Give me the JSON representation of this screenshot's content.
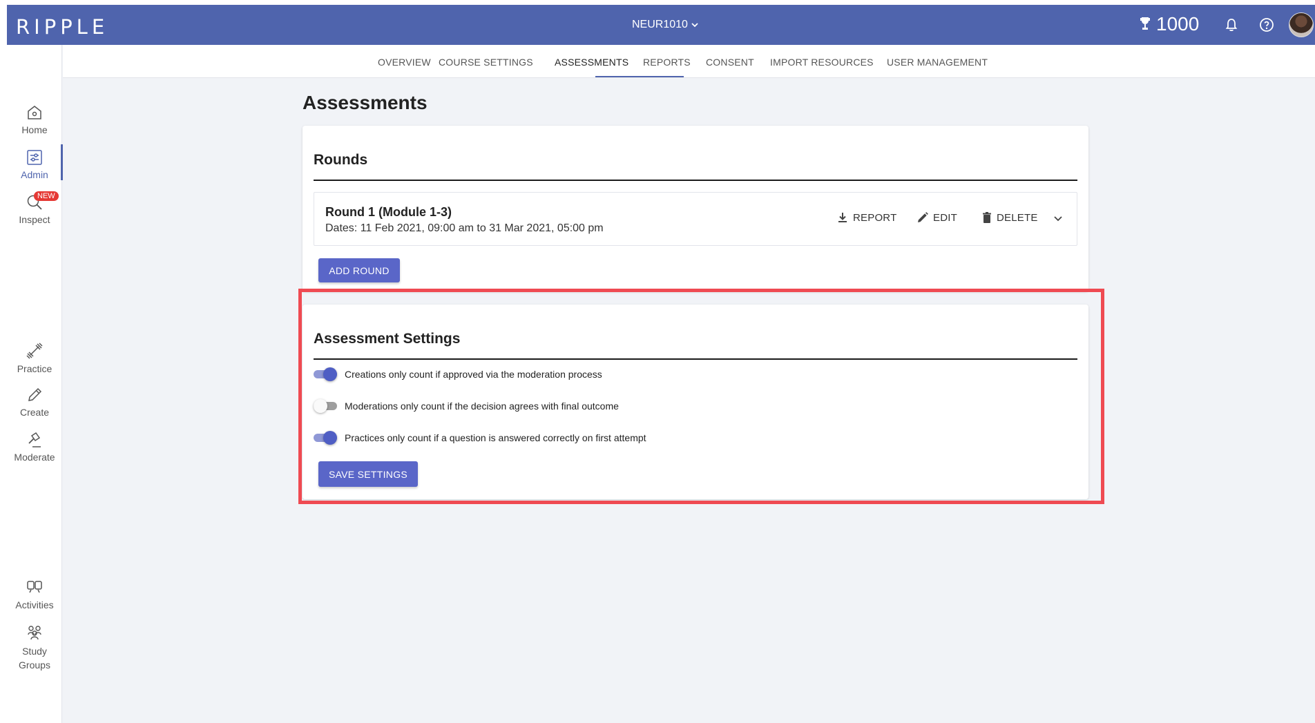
{
  "app": {
    "logo": "RIPPLE",
    "course": "NEUR1010",
    "points": "1000"
  },
  "colors": {
    "brand": "#4f64ad",
    "button": "#5a66c8",
    "highlight": "#ef4a52",
    "badge": "#e53935"
  },
  "topbar_icons": [
    "trophy-icon",
    "bell-icon",
    "help-icon",
    "avatar"
  ],
  "sidebar": {
    "items": [
      {
        "label": "Home",
        "icon": "home-icon"
      },
      {
        "label": "Admin",
        "icon": "admin-icon"
      },
      {
        "label": "Inspect",
        "icon": "inspect-icon",
        "badge": "NEW"
      },
      {
        "label": "Practice",
        "icon": "dumbbell-icon"
      },
      {
        "label": "Create",
        "icon": "pencil-icon"
      },
      {
        "label": "Moderate",
        "icon": "gavel-icon"
      },
      {
        "label": "Activities",
        "icon": "activities-icon"
      },
      {
        "label": "Study",
        "label2": "Groups",
        "icon": "groups-icon"
      }
    ]
  },
  "tabs": [
    {
      "label": "OVERVIEW"
    },
    {
      "label": "COURSE SETTINGS"
    },
    {
      "label": "ASSESSMENTS",
      "active": true
    },
    {
      "label": "REPORTS"
    },
    {
      "label": "CONSENT"
    },
    {
      "label": "IMPORT RESOURCES"
    },
    {
      "label": "USER MANAGEMENT"
    }
  ],
  "page": {
    "title": "Assessments"
  },
  "rounds": {
    "title": "Rounds",
    "round": {
      "name": "Round 1 (Module 1-3)",
      "dates": "Dates: 11 Feb 2021, 09:00 am to 31 Mar 2021, 05:00 pm",
      "report_label": "REPORT",
      "edit_label": "EDIT",
      "delete_label": "DELETE"
    },
    "add_label": "ADD ROUND"
  },
  "settings": {
    "title": "Assessment Settings",
    "toggles": [
      {
        "label": "Creations only count if approved via the moderation process",
        "on": true
      },
      {
        "label": "Moderations only count if the decision agrees with final outcome",
        "on": false
      },
      {
        "label": "Practices only count if a question is answered correctly on first attempt",
        "on": true
      }
    ],
    "save_label": "SAVE SETTINGS"
  }
}
